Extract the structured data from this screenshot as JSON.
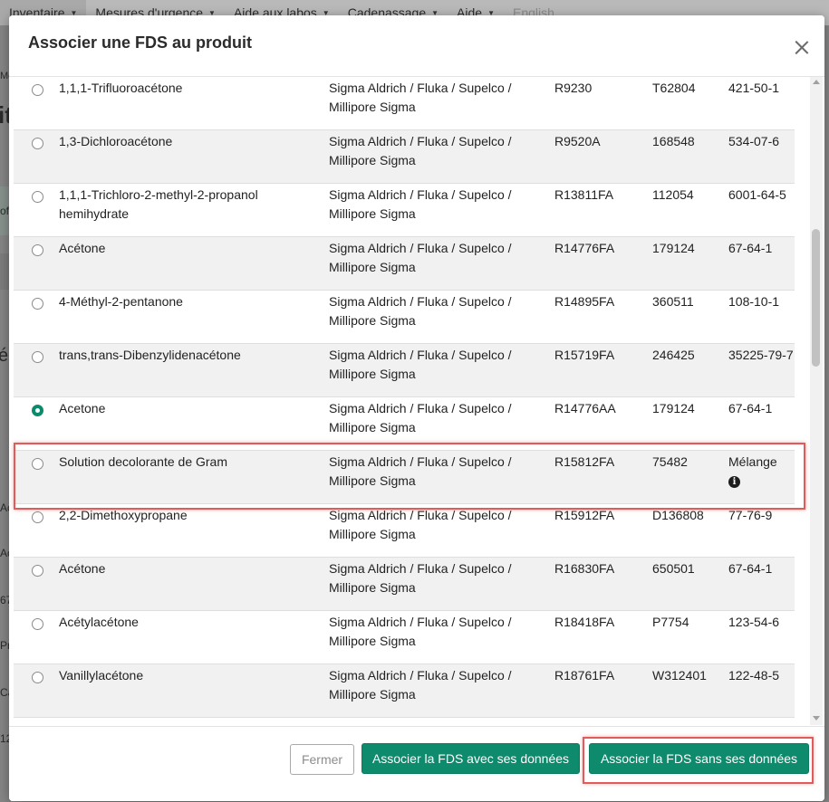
{
  "topnav": {
    "items": [
      {
        "label": "Inventaire"
      },
      {
        "label": "Mesures d'urgence"
      },
      {
        "label": "Aide aux labos"
      },
      {
        "label": "Cadenassage"
      },
      {
        "label": "Aide"
      },
      {
        "label": "English"
      }
    ]
  },
  "background": {
    "stubs": [
      "Me",
      "it",
      "of",
      "é",
      "Ac",
      "Ac",
      "67",
      "Pr",
      "Ca",
      "12"
    ]
  },
  "modal": {
    "title": "Associer une FDS au produit",
    "rows": [
      {
        "name": "1,1,1-Trifluoroacétone",
        "supplier": "Sigma Aldrich / Fluka / Supelco / Millipore Sigma",
        "ref": "R9230",
        "product": "T62804",
        "cas": "421-50-1",
        "selected": false
      },
      {
        "name": "1,3-Dichloroacétone",
        "supplier": "Sigma Aldrich / Fluka / Supelco / Millipore Sigma",
        "ref": "R9520A",
        "product": "168548",
        "cas": "534-07-6",
        "selected": false
      },
      {
        "name": "1,1,1-Trichloro-2-methyl-2-propanol hemihydrate",
        "supplier": "Sigma Aldrich / Fluka / Supelco / Millipore Sigma",
        "ref": "R13811FA",
        "product": "112054",
        "cas": "6001-64-5",
        "selected": false
      },
      {
        "name": "Acétone",
        "supplier": "Sigma Aldrich / Fluka / Supelco / Millipore Sigma",
        "ref": "R14776FA",
        "product": "179124",
        "cas": "67-64-1",
        "selected": false
      },
      {
        "name": "4-Méthyl-2-pentanone",
        "supplier": "Sigma Aldrich / Fluka / Supelco / Millipore Sigma",
        "ref": "R14895FA",
        "product": "360511",
        "cas": "108-10-1",
        "selected": false
      },
      {
        "name": "trans,trans-Dibenzylidenacétone",
        "supplier": "Sigma Aldrich / Fluka / Supelco / Millipore Sigma",
        "ref": "R15719FA",
        "product": "246425",
        "cas": "35225-79-7",
        "selected": false
      },
      {
        "name": "Acetone",
        "supplier": "Sigma Aldrich / Fluka / Supelco / Millipore Sigma",
        "ref": "R14776AA",
        "product": "179124",
        "cas": "67-64-1",
        "selected": true
      },
      {
        "name": "Solution decolorante de Gram",
        "supplier": "Sigma Aldrich / Fluka / Supelco / Millipore Sigma",
        "ref": "R15812FA",
        "product": "75482",
        "cas": "Mélange",
        "info": true,
        "selected": false
      },
      {
        "name": "2,2-Dimethoxypropane",
        "supplier": "Sigma Aldrich / Fluka / Supelco / Millipore Sigma",
        "ref": "R15912FA",
        "product": "D136808",
        "cas": "77-76-9",
        "selected": false
      },
      {
        "name": "Acétone",
        "supplier": "Sigma Aldrich / Fluka / Supelco / Millipore Sigma",
        "ref": "R16830FA",
        "product": "650501",
        "cas": "67-64-1",
        "selected": false
      },
      {
        "name": "Acétylacétone",
        "supplier": "Sigma Aldrich / Fluka / Supelco / Millipore Sigma",
        "ref": "R18418FA",
        "product": "P7754",
        "cas": "123-54-6",
        "selected": false
      },
      {
        "name": "Vanillylacétone",
        "supplier": "Sigma Aldrich / Fluka / Supelco / Millipore Sigma",
        "ref": "R18761FA",
        "product": "W312401",
        "cas": "122-48-5",
        "selected": false
      }
    ],
    "buttons": {
      "close": "Fermer",
      "with_data": "Associer la FDS avec ses données",
      "without_data": "Associer la FDS sans ses données"
    },
    "accent_color": "#0e8a6c",
    "highlight_color": "#e15b5b"
  }
}
